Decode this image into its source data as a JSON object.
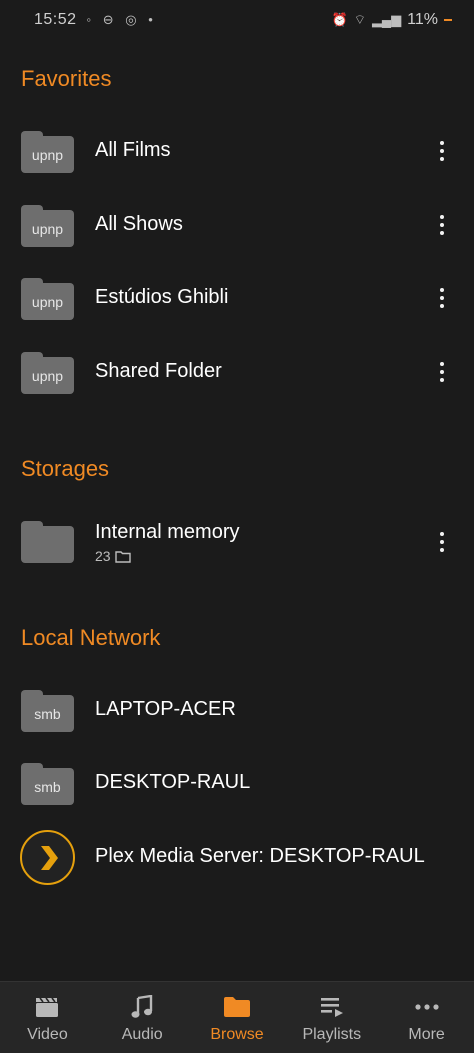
{
  "status_bar": {
    "time": "15:52",
    "battery": "11%"
  },
  "favorites": {
    "title": "Favorites",
    "items": [
      {
        "badge": "upnp",
        "label": "All Films"
      },
      {
        "badge": "upnp",
        "label": "All Shows"
      },
      {
        "badge": "upnp",
        "label": "Estúdios Ghibli"
      },
      {
        "badge": "upnp",
        "label": "Shared Folder"
      }
    ]
  },
  "storages": {
    "title": "Storages",
    "items": [
      {
        "label": "Internal memory",
        "count": "23"
      }
    ]
  },
  "local_network": {
    "title": "Local Network",
    "items": [
      {
        "badge": "smb",
        "label": "LAPTOP-ACER"
      },
      {
        "badge": "smb",
        "label": "DESKTOP-RAUL"
      },
      {
        "badge": "",
        "label": "Plex Media Server: DESKTOP-RAUL"
      }
    ]
  },
  "bottom_nav": {
    "items": [
      {
        "label": "Video",
        "icon": "clapperboard-icon"
      },
      {
        "label": "Audio",
        "icon": "music-note-icon"
      },
      {
        "label": "Browse",
        "icon": "folder-icon",
        "active": true
      },
      {
        "label": "Playlists",
        "icon": "playlist-icon"
      },
      {
        "label": "More",
        "icon": "more-dots-icon"
      }
    ]
  },
  "colors": {
    "accent": "#f08a24",
    "background": "#1b1b1b",
    "folder": "#6e6e6e",
    "plex": "#e5a00d"
  }
}
